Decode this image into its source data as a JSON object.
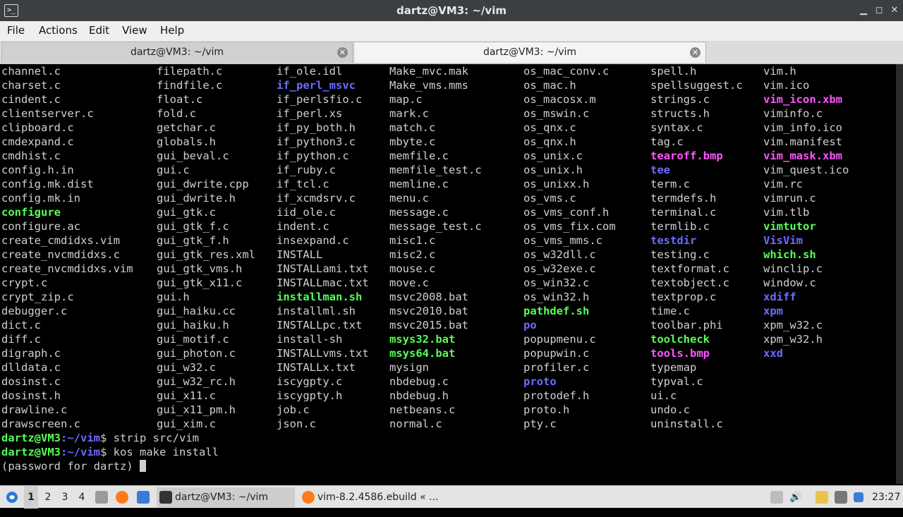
{
  "window": {
    "title": "dartz@VM3: ~/vim",
    "app_icon": "terminal-icon"
  },
  "menu": [
    "File",
    "Actions",
    "Edit",
    "View",
    "Help"
  ],
  "tabs": [
    {
      "label": "dartz@VM3: ~/vim",
      "active": false
    },
    {
      "label": "dartz@VM3: ~/vim",
      "active": true
    }
  ],
  "terminal": {
    "columns": [
      [
        [
          "channel.c",
          ""
        ],
        [
          "charset.c",
          ""
        ],
        [
          "cindent.c",
          ""
        ],
        [
          "clientserver.c",
          ""
        ],
        [
          "clipboard.c",
          ""
        ],
        [
          "cmdexpand.c",
          ""
        ],
        [
          "cmdhist.c",
          ""
        ],
        [
          "config.h.in",
          ""
        ],
        [
          "config.mk.dist",
          ""
        ],
        [
          "config.mk.in",
          ""
        ],
        [
          "configure",
          "exe"
        ],
        [
          "configure.ac",
          ""
        ],
        [
          "create_cmdidxs.vim",
          ""
        ],
        [
          "create_nvcmdidxs.c",
          ""
        ],
        [
          "create_nvcmdidxs.vim",
          ""
        ],
        [
          "crypt.c",
          ""
        ],
        [
          "crypt_zip.c",
          ""
        ],
        [
          "debugger.c",
          ""
        ],
        [
          "dict.c",
          ""
        ],
        [
          "diff.c",
          ""
        ],
        [
          "digraph.c",
          ""
        ],
        [
          "dlldata.c",
          ""
        ],
        [
          "dosinst.c",
          ""
        ],
        [
          "dosinst.h",
          ""
        ],
        [
          "drawline.c",
          ""
        ],
        [
          "drawscreen.c",
          ""
        ]
      ],
      [
        [
          "filepath.c",
          ""
        ],
        [
          "findfile.c",
          ""
        ],
        [
          "float.c",
          ""
        ],
        [
          "fold.c",
          ""
        ],
        [
          "getchar.c",
          ""
        ],
        [
          "globals.h",
          ""
        ],
        [
          "gui_beval.c",
          ""
        ],
        [
          "gui.c",
          ""
        ],
        [
          "gui_dwrite.cpp",
          ""
        ],
        [
          "gui_dwrite.h",
          ""
        ],
        [
          "gui_gtk.c",
          ""
        ],
        [
          "gui_gtk_f.c",
          ""
        ],
        [
          "gui_gtk_f.h",
          ""
        ],
        [
          "gui_gtk_res.xml",
          ""
        ],
        [
          "gui_gtk_vms.h",
          ""
        ],
        [
          "gui_gtk_x11.c",
          ""
        ],
        [
          "gui.h",
          ""
        ],
        [
          "gui_haiku.cc",
          ""
        ],
        [
          "gui_haiku.h",
          ""
        ],
        [
          "gui_motif.c",
          ""
        ],
        [
          "gui_photon.c",
          ""
        ],
        [
          "gui_w32.c",
          ""
        ],
        [
          "gui_w32_rc.h",
          ""
        ],
        [
          "gui_x11.c",
          ""
        ],
        [
          "gui_x11_pm.h",
          ""
        ],
        [
          "gui_xim.c",
          ""
        ]
      ],
      [
        [
          "if_ole.idl",
          ""
        ],
        [
          "if_perl_msvc",
          "dir"
        ],
        [
          "if_perlsfio.c",
          ""
        ],
        [
          "if_perl.xs",
          ""
        ],
        [
          "if_py_both.h",
          ""
        ],
        [
          "if_python3.c",
          ""
        ],
        [
          "if_python.c",
          ""
        ],
        [
          "if_ruby.c",
          ""
        ],
        [
          "if_tcl.c",
          ""
        ],
        [
          "if_xcmdsrv.c",
          ""
        ],
        [
          "iid_ole.c",
          ""
        ],
        [
          "indent.c",
          ""
        ],
        [
          "insexpand.c",
          ""
        ],
        [
          "INSTALL",
          ""
        ],
        [
          "INSTALLami.txt",
          ""
        ],
        [
          "INSTALLmac.txt",
          ""
        ],
        [
          "installman.sh",
          "exe"
        ],
        [
          "installml.sh",
          ""
        ],
        [
          "INSTALLpc.txt",
          ""
        ],
        [
          "install-sh",
          ""
        ],
        [
          "INSTALLvms.txt",
          ""
        ],
        [
          "INSTALLx.txt",
          ""
        ],
        [
          "iscygpty.c",
          ""
        ],
        [
          "iscygpty.h",
          ""
        ],
        [
          "job.c",
          ""
        ],
        [
          "json.c",
          ""
        ]
      ],
      [
        [
          "Make_mvc.mak",
          ""
        ],
        [
          "Make_vms.mms",
          ""
        ],
        [
          "map.c",
          ""
        ],
        [
          "mark.c",
          ""
        ],
        [
          "match.c",
          ""
        ],
        [
          "mbyte.c",
          ""
        ],
        [
          "memfile.c",
          ""
        ],
        [
          "memfile_test.c",
          ""
        ],
        [
          "memline.c",
          ""
        ],
        [
          "menu.c",
          ""
        ],
        [
          "message.c",
          ""
        ],
        [
          "message_test.c",
          ""
        ],
        [
          "misc1.c",
          ""
        ],
        [
          "misc2.c",
          ""
        ],
        [
          "mouse.c",
          ""
        ],
        [
          "move.c",
          ""
        ],
        [
          "msvc2008.bat",
          ""
        ],
        [
          "msvc2010.bat",
          ""
        ],
        [
          "msvc2015.bat",
          ""
        ],
        [
          "msys32.bat",
          "exe"
        ],
        [
          "msys64.bat",
          "exe"
        ],
        [
          "mysign",
          ""
        ],
        [
          "nbdebug.c",
          ""
        ],
        [
          "nbdebug.h",
          ""
        ],
        [
          "netbeans.c",
          ""
        ],
        [
          "normal.c",
          ""
        ]
      ],
      [
        [
          "os_mac_conv.c",
          ""
        ],
        [
          "os_mac.h",
          ""
        ],
        [
          "os_macosx.m",
          ""
        ],
        [
          "os_mswin.c",
          ""
        ],
        [
          "os_qnx.c",
          ""
        ],
        [
          "os_qnx.h",
          ""
        ],
        [
          "os_unix.c",
          ""
        ],
        [
          "os_unix.h",
          ""
        ],
        [
          "os_unixx.h",
          ""
        ],
        [
          "os_vms.c",
          ""
        ],
        [
          "os_vms_conf.h",
          ""
        ],
        [
          "os_vms_fix.com",
          ""
        ],
        [
          "os_vms_mms.c",
          ""
        ],
        [
          "os_w32dll.c",
          ""
        ],
        [
          "os_w32exe.c",
          ""
        ],
        [
          "os_win32.c",
          ""
        ],
        [
          "os_win32.h",
          ""
        ],
        [
          "pathdef.sh",
          "exe"
        ],
        [
          "po",
          "dir"
        ],
        [
          "popupmenu.c",
          ""
        ],
        [
          "popupwin.c",
          ""
        ],
        [
          "profiler.c",
          ""
        ],
        [
          "proto",
          "dir"
        ],
        [
          "protodef.h",
          ""
        ],
        [
          "proto.h",
          ""
        ],
        [
          "pty.c",
          ""
        ]
      ],
      [
        [
          "spell.h",
          ""
        ],
        [
          "spellsuggest.c",
          ""
        ],
        [
          "strings.c",
          ""
        ],
        [
          "structs.h",
          ""
        ],
        [
          "syntax.c",
          ""
        ],
        [
          "tag.c",
          ""
        ],
        [
          "tearoff.bmp",
          "img"
        ],
        [
          "tee",
          "dir"
        ],
        [
          "term.c",
          ""
        ],
        [
          "termdefs.h",
          ""
        ],
        [
          "terminal.c",
          ""
        ],
        [
          "termlib.c",
          ""
        ],
        [
          "testdir",
          "dir"
        ],
        [
          "testing.c",
          ""
        ],
        [
          "textformat.c",
          ""
        ],
        [
          "textobject.c",
          ""
        ],
        [
          "textprop.c",
          ""
        ],
        [
          "time.c",
          ""
        ],
        [
          "toolbar.phi",
          ""
        ],
        [
          "toolcheck",
          "exe"
        ],
        [
          "tools.bmp",
          "img"
        ],
        [
          "typemap",
          ""
        ],
        [
          "typval.c",
          ""
        ],
        [
          "ui.c",
          ""
        ],
        [
          "undo.c",
          ""
        ],
        [
          "uninstall.c",
          ""
        ]
      ],
      [
        [
          "vim.h",
          ""
        ],
        [
          "vim.ico",
          ""
        ],
        [
          "vim_icon.xbm",
          "img"
        ],
        [
          "viminfo.c",
          ""
        ],
        [
          "vim_info.ico",
          ""
        ],
        [
          "vim.manifest",
          ""
        ],
        [
          "vim_mask.xbm",
          "img"
        ],
        [
          "vim_quest.ico",
          ""
        ],
        [
          "vim.rc",
          ""
        ],
        [
          "vimrun.c",
          ""
        ],
        [
          "vim.tlb",
          ""
        ],
        [
          "vimtutor",
          "exe"
        ],
        [
          "VisVim",
          "dir"
        ],
        [
          "which.sh",
          "exe"
        ],
        [
          "winclip.c",
          ""
        ],
        [
          "window.c",
          ""
        ],
        [
          "xdiff",
          "dir"
        ],
        [
          "xpm",
          "dir"
        ],
        [
          "xpm_w32.c",
          ""
        ],
        [
          "xpm_w32.h",
          ""
        ],
        [
          "xxd",
          "dir"
        ]
      ]
    ],
    "prompts": [
      {
        "user": "dartz@VM3",
        "path": ":~/vim",
        "cmd": "$ strip src/vim"
      },
      {
        "user": "dartz@VM3",
        "path": ":~/vim",
        "cmd": "$ kos make install"
      }
    ],
    "last_line": "(password for dartz) "
  },
  "taskbar": {
    "workspaces": [
      "1",
      "2",
      "3",
      "4"
    ],
    "current_workspace": "1",
    "tasks": [
      {
        "label": "dartz@VM3: ~/vim",
        "icon": "terminal-icon"
      },
      {
        "label": "vim-8.2.4586.ebuild « ...",
        "icon": "firefox-icon"
      }
    ],
    "clock": "23:27"
  },
  "colors": {
    "exe": "#55ff55",
    "dir": "#6c6cff",
    "img": "#ff55ff",
    "bg": "#000000",
    "fg": "#d0d0d0"
  }
}
